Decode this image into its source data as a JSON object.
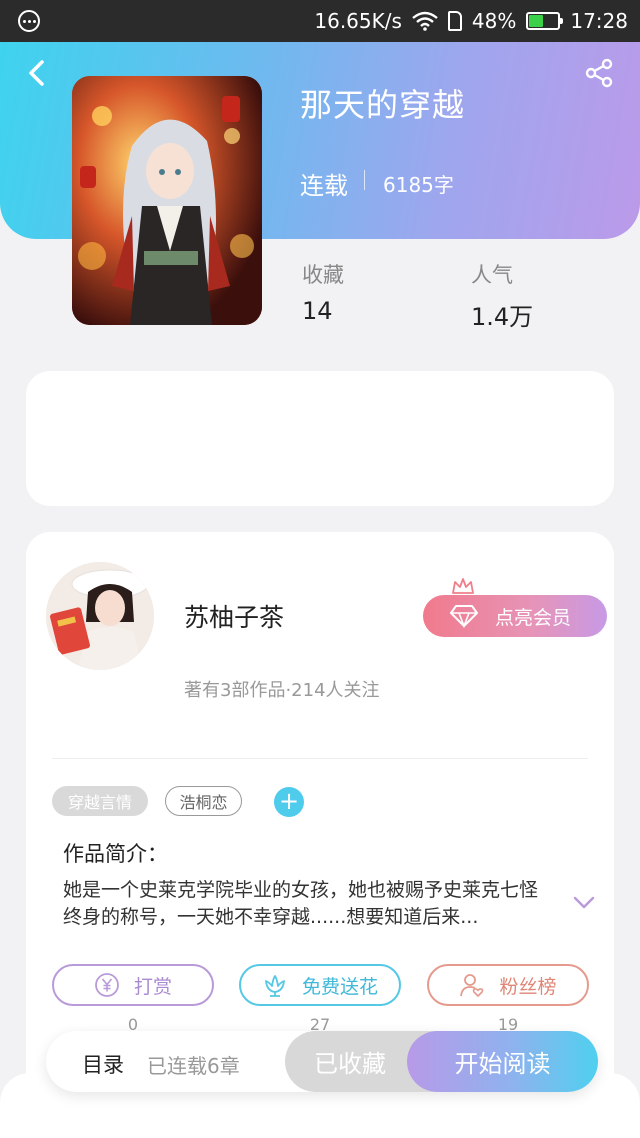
{
  "status_bar": {
    "speed": "16.65K/s",
    "battery": "48%",
    "time": "17:28"
  },
  "book": {
    "title": "那天的穿越",
    "status": "连载",
    "words": "6185字"
  },
  "stats": [
    {
      "label": "收藏",
      "value": "14"
    },
    {
      "label": "人气",
      "value": "1.4万"
    }
  ],
  "author": {
    "name": "苏柚子茶",
    "meta": "著有3部作品·214人关注",
    "vip_label": "点亮会员"
  },
  "tags": [
    "穿越言情",
    "浩桐恋"
  ],
  "intro": {
    "title": "作品简介：",
    "text": "她是一个史莱克学院毕业的女孩，她也被赐予史莱克七怪终身的称号，一天她不幸穿越......想要知道后来..."
  },
  "actions": [
    {
      "label": "打赏",
      "count": "0"
    },
    {
      "label": "免费送花",
      "count": "27"
    },
    {
      "label": "粉丝榜",
      "count": "19"
    }
  ],
  "bottom_bar": {
    "toc_label": "目录",
    "toc_meta": "已连载6章",
    "collected_label": "已收藏",
    "read_label": "开始阅读"
  },
  "colors": {
    "header_gradient_start": "#3ed3ee",
    "header_gradient_end": "#bb9ae9",
    "accent_cyan": "#4fcbec"
  }
}
